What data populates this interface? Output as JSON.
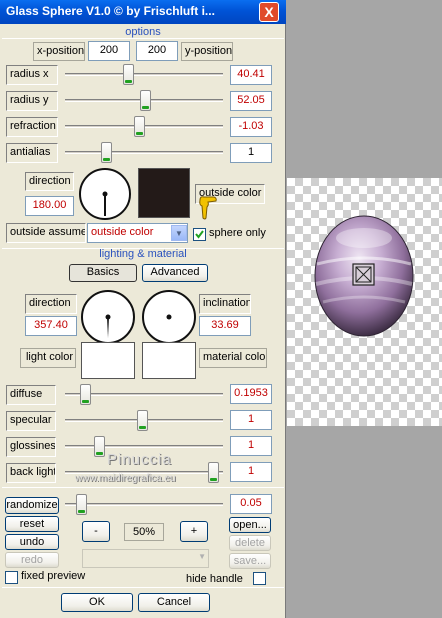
{
  "window": {
    "title": "Glass Sphere V1.0 © by Frischluft i...",
    "close_label": "X"
  },
  "options": {
    "header": "options",
    "x_label": "x-position",
    "x_value": "200",
    "y_label": "y-position",
    "y_value": "200",
    "sliders": [
      {
        "label": "radius x",
        "value": "40.41"
      },
      {
        "label": "radius y",
        "value": "52.05"
      },
      {
        "label": "refraction",
        "value": "-1.03"
      },
      {
        "label": "antialias",
        "value": "1"
      }
    ],
    "direction_label": "direction",
    "direction_value": "180.00",
    "outside_color_label": "outside color",
    "outside_assume_label": "outside assume",
    "outside_assume_value": "outside color",
    "sphere_only_label": "sphere only",
    "sphere_only_checked": true,
    "outside_color": "#231a18"
  },
  "lighting": {
    "header": "lighting & material",
    "basics_label": "Basics",
    "advanced_label": "Advanced",
    "direction_label": "direction",
    "direction_value": "357.40",
    "inclination_label": "inclination",
    "inclination_value": "33.69",
    "light_color_label": "light color",
    "material_color_label": "material color",
    "light_color": "#ffffff",
    "material_color": "#ffffff",
    "sliders": [
      {
        "label": "diffuse",
        "value": "0.1953"
      },
      {
        "label": "specular",
        "value": "1"
      },
      {
        "label": "glossiness",
        "value": "1"
      },
      {
        "label": "back light",
        "value": "1"
      }
    ]
  },
  "bottom": {
    "randomize_label": "randomize",
    "randomize_value": "0.05",
    "reset_label": "reset",
    "undo_label": "undo",
    "redo_label": "redo",
    "minus_label": "-",
    "zoom_value": "50%",
    "plus_label": "+",
    "open_label": "open...",
    "delete_label": "delete",
    "save_label": "save...",
    "fixed_preview_label": "fixed preview",
    "hide_handle_label": "hide handle",
    "ok_label": "OK",
    "cancel_label": "Cancel"
  },
  "watermark": {
    "line1": "Pinuccia",
    "line2": "www.maidiregrafica.eu"
  }
}
